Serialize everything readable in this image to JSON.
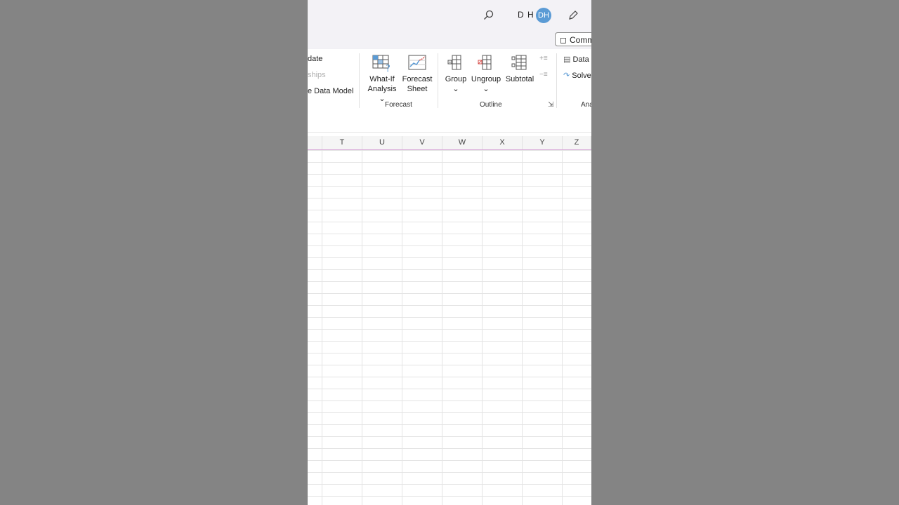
{
  "titlebar": {
    "user_initials": "D H",
    "avatar_initials": "DH",
    "comments_label": "Comm"
  },
  "ribbon": {
    "queries_group": {
      "item1": "date",
      "item2": "ships",
      "item3": "e Data Model"
    },
    "forecast_group": {
      "whatif_line1": "What-If",
      "whatif_line2": "Analysis",
      "forecast_line1": "Forecast",
      "forecast_line2": "Sheet",
      "label": "Forecast"
    },
    "outline_group": {
      "group_label": "Group",
      "ungroup_label": "Ungroup",
      "subtotal_label": "Subtotal",
      "label": "Outline"
    },
    "analyze_group": {
      "data_label": "Data",
      "solver_label": "Solve",
      "label": "Ana"
    }
  },
  "sheet": {
    "columns": [
      "T",
      "U",
      "V",
      "W",
      "X",
      "Y",
      "Z"
    ]
  },
  "colors": {
    "avatar": "#5b9bd5",
    "header_accent": "#d7a6d7",
    "ribbon_bg": "#ffffff",
    "titlebar_bg": "#f3f2f6"
  }
}
